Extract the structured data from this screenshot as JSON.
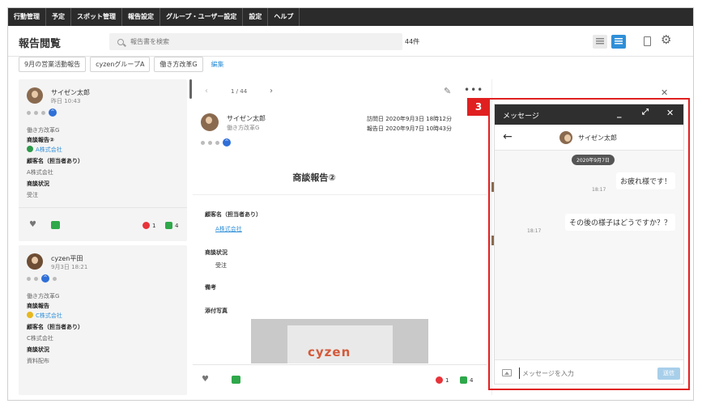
{
  "nav": [
    "行動管理",
    "予定",
    "スポット管理",
    "報告設定",
    "グループ・ユーザー設定",
    "設定",
    "ヘルプ"
  ],
  "header": {
    "title": "報告閲覧",
    "search_placeholder": "報告書を検索",
    "count": "44件"
  },
  "filters": {
    "tags": [
      "9月の営業活動報告",
      "cyzenグループA",
      "働き方改革G"
    ],
    "edit": "編集"
  },
  "list": [
    {
      "name": "サイゼン太郎",
      "date": "昨日 10:43",
      "group": "働き方改革G",
      "report": "商談報告②",
      "company": "A株式会社",
      "customer_label": "顧客名（担当者あり）",
      "customer_value": "A株式会社",
      "status_label": "商談状況",
      "status_value": "受注",
      "heart_count": "1",
      "comment_count": "4"
    },
    {
      "name": "cyzen平田",
      "date": "9月3日 18:21",
      "group": "働き方改革G",
      "report": "商談報告",
      "company": "C株式会社",
      "customer_label": "顧客名（担当者あり）",
      "customer_value": "C株式会社",
      "status_label": "商談状況",
      "status_value": "資料配布"
    }
  ],
  "detail": {
    "pager": "1 / 44",
    "name": "サイゼン太郎",
    "group": "働き方改革G",
    "visit": "訪問日  2020年9月3日 18時12分",
    "report_date": "報告日  2020年9月7日 10時43分",
    "title": "商談報告②",
    "customer_label": "顧客名（担当者あり）",
    "customer_value": "A株式会社",
    "status_label": "商談状況",
    "status_value": "受注",
    "note_label": "備考",
    "photo_label": "添付写真",
    "photo_logo": "cyzen",
    "heart_count": "1",
    "comment_count": "4"
  },
  "badge": "3",
  "message": {
    "title": "メッセージ",
    "user": "サイゼン太郎",
    "date": "2020年9月7日",
    "bubbles": [
      {
        "text": "お疲れ様です！",
        "time": "18:17"
      },
      {
        "text": "その後の様子はどうですか？？",
        "time": "18:17"
      }
    ],
    "input_placeholder": "メッセージを入力",
    "send": "送信"
  }
}
